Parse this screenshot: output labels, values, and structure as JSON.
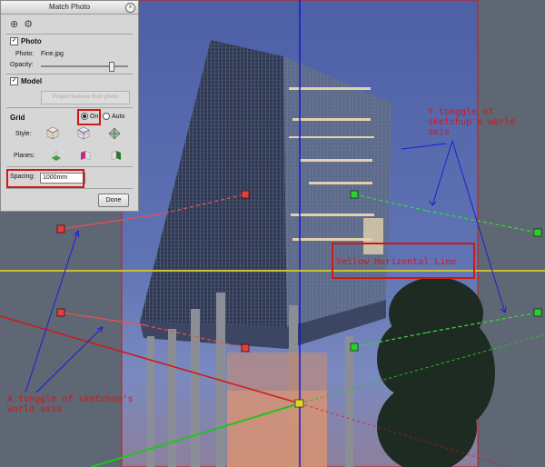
{
  "panel": {
    "title": "Match Photo",
    "close_glyph": "x",
    "toolbar": {
      "add_icon": "⊕",
      "settings_icon": "⚙"
    },
    "photo": {
      "section_label": "Photo",
      "photo_label": "Photo:",
      "photo_value": "Fine.jpg",
      "opacity_label": "Opacity:"
    },
    "model": {
      "section_label": "Model",
      "project_button": "Project textures from photo"
    },
    "grid": {
      "section_label": "Grid",
      "on_label": "On",
      "auto_label": "Auto",
      "style_label": "Style:",
      "planes_label": "Planes:",
      "spacing_label": "Spacing:",
      "spacing_value": "1000mm"
    },
    "done_label": "Done"
  },
  "annotations": {
    "y_line1": "Y tonggle of",
    "y_line2": "sketchup's world",
    "y_line3": "axis",
    "horizon_label": "Yellow Horizontal Line",
    "x_line1": "X tonggle of sketchup's",
    "x_line2": "world axis"
  },
  "colors": {
    "annotation": "#d01818",
    "horizon": "#c8c032",
    "blue_axis": "#1515d8",
    "green_axis": "#22c222",
    "red_axis": "#d01818",
    "background": "#5f6674"
  }
}
